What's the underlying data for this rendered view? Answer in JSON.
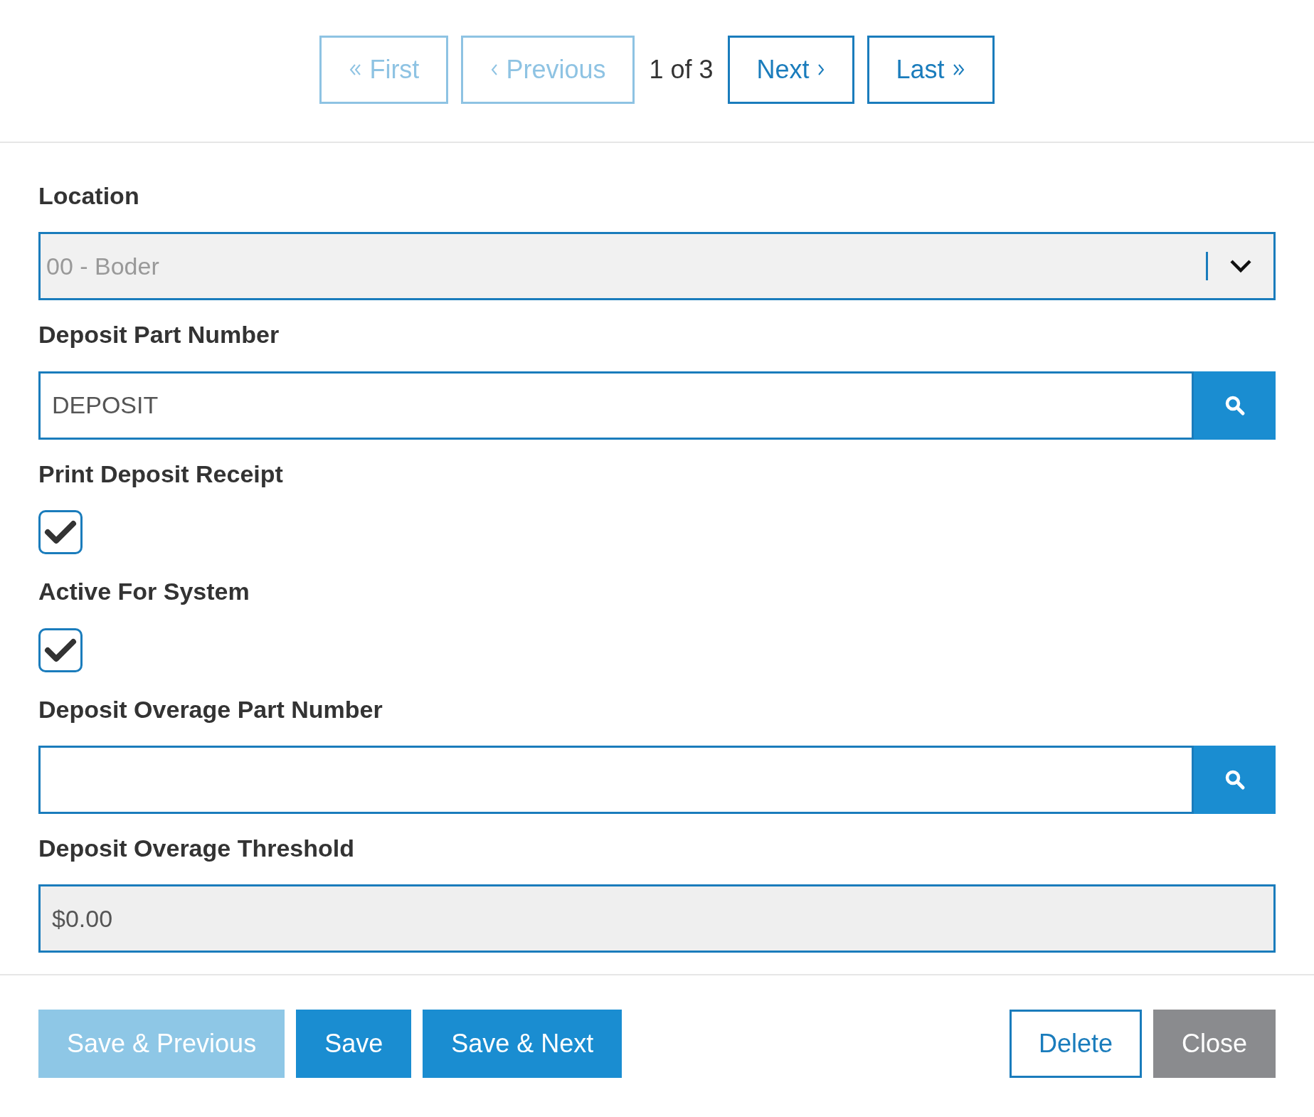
{
  "pager": {
    "buttons": [
      {
        "label": "First",
        "disabled": true
      },
      {
        "label": "Previous",
        "disabled": true
      },
      {
        "kind": "indicator",
        "label": "1 of 3"
      },
      {
        "label": "Next",
        "disabled": false
      },
      {
        "label": "Last",
        "disabled": false
      }
    ]
  },
  "fields": [
    {
      "kind": "select",
      "label": "Location",
      "value": "00 - Boder",
      "disabled": true
    },
    {
      "kind": "lookup",
      "label": "Deposit Part Number",
      "value": "DEPOSIT",
      "disabled": false
    },
    {
      "kind": "checkbox",
      "label": "Print Deposit Receipt",
      "checked": true
    },
    {
      "kind": "checkbox",
      "label": "Active For System",
      "checked": true
    },
    {
      "kind": "lookup",
      "label": "Deposit Overage Part Number",
      "disabled": false
    },
    {
      "kind": "text",
      "label": "Deposit Overage Threshold",
      "value": "$0.00",
      "disabled": true
    }
  ],
  "footer": {
    "buttons": [
      {
        "label": "Save & Previous",
        "kind": "primary",
        "disabled": true
      },
      {
        "label": "Save",
        "kind": "primary",
        "disabled": false
      },
      {
        "label": "Save & Next",
        "kind": "primary",
        "disabled": false
      },
      {
        "label": "Delete",
        "kind": "outline",
        "disabled": false
      },
      {
        "label": "Close",
        "kind": "secondary",
        "disabled": false
      }
    ]
  }
}
